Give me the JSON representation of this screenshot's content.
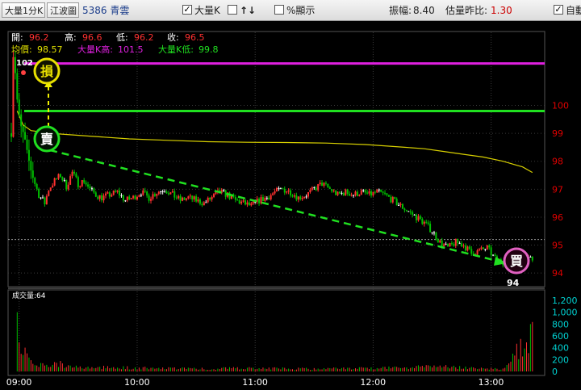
{
  "toolbar": {
    "mode_label": "大量1分K",
    "source_label": "江波圖",
    "stock_label": "5386 青雲",
    "big_k_label": "大量K",
    "big_k_checked": "✓",
    "sort_icon_glyph": "↑↓",
    "pct_label": "%顯示",
    "amplitude_label": "振幅:",
    "amplitude_value": "8.40",
    "vol_ratio_label": "估量昨比:",
    "vol_ratio_value": "1.30",
    "auto_label": "自動",
    "auto_checked": "✓"
  },
  "info": {
    "open_label": "開:",
    "open_value": "96.2",
    "high_label": "高:",
    "high_value": "96.6",
    "low_label": "低:",
    "low_value": "96.2",
    "close_label": "收:",
    "close_value": "96.5",
    "avg_label": "均價:",
    "avg_value": "98.57",
    "bigk_high_label": "大量K高:",
    "bigk_high_value": "101.5",
    "bigk_low_label": "大量K低:",
    "bigk_low_value": "99.8",
    "peak_label": "102",
    "trough_label": "94"
  },
  "markers": {
    "stop_loss": "損",
    "sell": "賣",
    "buy": "買"
  },
  "volume_title": "成交量:64",
  "colors": {
    "up": "#ff3030",
    "down": "#00c000",
    "neutral": "#ffffff",
    "avg_line": "#d8d000",
    "bigk_high_line": "#e020e0",
    "bigk_low_line": "#20e020",
    "axis_text": "#e00000",
    "vol_axis_text": "#00d0d0",
    "grid": "#3a3a3a"
  },
  "chart_data": {
    "type": "candlestick",
    "x_ticks": [
      "09:00",
      "10:00",
      "11:00",
      "12:00",
      "13:00"
    ],
    "price_ticks": [
      94,
      95,
      96,
      97,
      98,
      99,
      100
    ],
    "price_range": [
      93.6,
      102.5
    ],
    "volume_ticks": [
      "0",
      "200",
      "400",
      "600",
      "800",
      "1,000",
      "1,200"
    ],
    "volume_range": [
      0,
      1200
    ],
    "reference_price": 95.2,
    "bigk_high": 101.5,
    "bigk_low": 99.8,
    "price_path": [
      [
        0,
        99.0
      ],
      [
        1,
        101.8
      ],
      [
        2,
        101.2
      ],
      [
        3,
        100.2
      ],
      [
        4,
        99.6
      ],
      [
        5,
        99.2
      ],
      [
        6,
        99.0
      ],
      [
        7,
        98.7
      ],
      [
        8,
        98.3
      ],
      [
        9,
        98.0
      ],
      [
        10,
        97.7
      ],
      [
        12,
        97.2
      ],
      [
        14,
        96.8
      ],
      [
        17,
        96.5
      ],
      [
        19,
        97.0
      ],
      [
        22,
        97.3
      ],
      [
        25,
        97.5
      ],
      [
        28,
        97.1
      ],
      [
        31,
        97.6
      ],
      [
        34,
        97.2
      ],
      [
        37,
        97.3
      ],
      [
        40,
        97.0
      ],
      [
        43,
        96.8
      ],
      [
        46,
        96.7
      ],
      [
        50,
        96.8
      ],
      [
        54,
        96.9
      ],
      [
        58,
        96.6
      ],
      [
        62,
        96.7
      ],
      [
        66,
        96.9
      ],
      [
        70,
        96.7
      ],
      [
        74,
        96.9
      ],
      [
        78,
        97.0
      ],
      [
        82,
        96.8
      ],
      [
        86,
        96.6
      ],
      [
        90,
        96.7
      ],
      [
        94,
        96.6
      ],
      [
        98,
        96.5
      ],
      [
        102,
        96.7
      ],
      [
        106,
        96.9
      ],
      [
        110,
        96.8
      ],
      [
        114,
        96.6
      ],
      [
        118,
        96.5
      ],
      [
        122,
        96.4
      ],
      [
        126,
        96.6
      ],
      [
        130,
        96.7
      ],
      [
        134,
        96.9
      ],
      [
        138,
        97.0
      ],
      [
        142,
        96.9
      ],
      [
        146,
        96.7
      ],
      [
        150,
        96.8
      ],
      [
        154,
        97.0
      ],
      [
        158,
        97.2
      ],
      [
        162,
        97.0
      ],
      [
        166,
        96.8
      ],
      [
        170,
        96.9
      ],
      [
        174,
        96.8
      ],
      [
        178,
        96.9
      ],
      [
        182,
        96.8
      ],
      [
        186,
        96.9
      ],
      [
        190,
        96.8
      ],
      [
        194,
        96.6
      ],
      [
        198,
        96.4
      ],
      [
        202,
        96.2
      ],
      [
        206,
        96.0
      ],
      [
        210,
        95.8
      ],
      [
        214,
        95.5
      ],
      [
        218,
        95.1
      ],
      [
        222,
        94.9
      ],
      [
        226,
        95.1
      ],
      [
        230,
        95.0
      ],
      [
        234,
        94.7
      ],
      [
        238,
        94.8
      ],
      [
        242,
        94.9
      ],
      [
        246,
        94.5
      ],
      [
        250,
        94.4
      ],
      [
        254,
        94.6
      ],
      [
        258,
        94.6
      ],
      [
        262,
        94.6
      ],
      [
        265,
        94.5
      ]
    ],
    "avg_path": [
      [
        3,
        99.8
      ],
      [
        6,
        99.3
      ],
      [
        10,
        99.1
      ],
      [
        20,
        99.0
      ],
      [
        40,
        98.9
      ],
      [
        60,
        98.8
      ],
      [
        80,
        98.75
      ],
      [
        100,
        98.7
      ],
      [
        120,
        98.68
      ],
      [
        140,
        98.67
      ],
      [
        160,
        98.65
      ],
      [
        180,
        98.6
      ],
      [
        200,
        98.5
      ],
      [
        210,
        98.45
      ],
      [
        220,
        98.35
      ],
      [
        230,
        98.25
      ],
      [
        240,
        98.15
      ],
      [
        250,
        98.0
      ],
      [
        260,
        97.8
      ],
      [
        265,
        97.6
      ]
    ],
    "volume_spikes": [
      [
        3,
        1000
      ],
      [
        4,
        620
      ],
      [
        5,
        520
      ],
      [
        6,
        450
      ],
      [
        7,
        380
      ],
      [
        8,
        300
      ],
      [
        9,
        240
      ],
      [
        10,
        200
      ],
      [
        12,
        160
      ],
      [
        15,
        140
      ],
      [
        20,
        120
      ],
      [
        24,
        180
      ],
      [
        30,
        100
      ],
      [
        40,
        90
      ],
      [
        60,
        80
      ],
      [
        90,
        60
      ],
      [
        120,
        70
      ],
      [
        150,
        60
      ],
      [
        180,
        70
      ],
      [
        200,
        90
      ],
      [
        210,
        120
      ],
      [
        220,
        100
      ],
      [
        230,
        80
      ],
      [
        240,
        60
      ],
      [
        250,
        50
      ],
      [
        264,
        800
      ]
    ]
  }
}
